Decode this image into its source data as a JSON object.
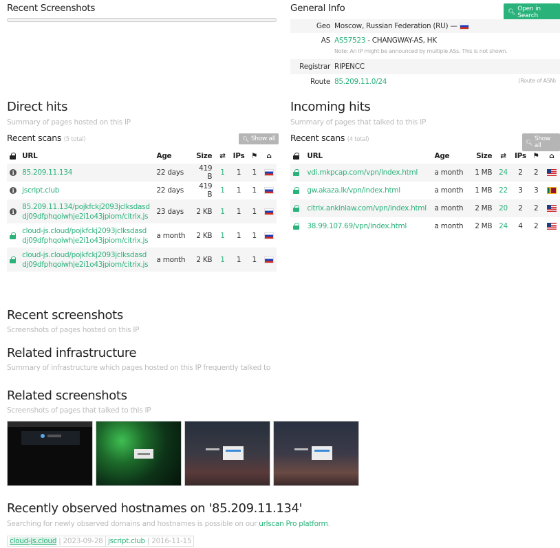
{
  "left_top": {
    "title": "Recent Screenshots"
  },
  "general": {
    "title": "General Info",
    "open_button": "Open in Search",
    "geo_label": "Geo",
    "geo_value": "Moscow, Russian Federation (RU) —",
    "as_label": "AS",
    "as_link": "AS57523",
    "as_rest": "- CHANGWAY-AS, HK",
    "as_note": "Note: An IP might be announced by multiple ASs. This is not shown.",
    "registrar_label": "Registrar",
    "registrar_value": "RIPENCC",
    "route_label": "Route",
    "route_value": "85.209.11.0/24",
    "route_note": "(Route of ASN)"
  },
  "direct": {
    "title": "Direct hits",
    "subtitle": "Summary of pages hosted on this IP",
    "recent_label": "Recent scans",
    "recent_count": "(5 total)",
    "show_all": "Show all",
    "headers": {
      "url": "URL",
      "age": "Age",
      "size": "Size",
      "ips": "IPs"
    },
    "rows": [
      {
        "icon": "info-icon",
        "url1": "85.209.11.134",
        "url2": "",
        "age": "22 days",
        "size": "419 B",
        "req": "1",
        "ips": "1",
        "ctry": "1",
        "flag": "ru"
      },
      {
        "icon": "info-icon",
        "url1": "jscript.club",
        "url2": "",
        "age": "22 days",
        "size": "419 B",
        "req": "1",
        "ips": "1",
        "ctry": "1",
        "flag": "ru"
      },
      {
        "icon": "info-icon",
        "url1": "85.209.11.134/pojkfckj2093jclksdasd",
        "url2": "dj09dfphqoiwhje2i1o43jpiom/citrix.js",
        "age": "23 days",
        "size": "2 KB",
        "req": "1",
        "ips": "1",
        "ctry": "1",
        "flag": "ru"
      },
      {
        "icon": "lock-icon",
        "url1": "cloud-js.cloud/pojkfckj2093jclksdasd",
        "url2": "dj09dfphqoiwhje2i1o43jpiom/citrix.js",
        "age": "a month",
        "size": "2 KB",
        "req": "1",
        "ips": "1",
        "ctry": "1",
        "flag": "ru"
      },
      {
        "icon": "lock-icon",
        "url1": "cloud-js.cloud/pojkfckj2093jclksdasd",
        "url2": "dj09dfphqoiwhje2i1o43jpiom/citrix.js",
        "age": "a month",
        "size": "2 KB",
        "req": "1",
        "ips": "1",
        "ctry": "1",
        "flag": "ru"
      }
    ]
  },
  "incoming": {
    "title": "Incoming hits",
    "subtitle": "Summary of pages that talked to this IP",
    "recent_label": "Recent scans",
    "recent_count": "(4 total)",
    "show_all": "Show all",
    "headers": {
      "url": "URL",
      "age": "Age",
      "size": "Size",
      "ips": "IPs"
    },
    "rows": [
      {
        "url": "vdi.mkpcap.com/vpn/index.html",
        "age": "a month",
        "size": "1 MB",
        "req": "24",
        "ips": "2",
        "ctry": "2",
        "flag": "us"
      },
      {
        "url": "gw.akaza.lk/vpn/index.html",
        "age": "a month",
        "size": "1 MB",
        "req": "22",
        "ips": "3",
        "ctry": "3",
        "flag": "lk"
      },
      {
        "url": "citrix.ankinlaw.com/vpn/index.html",
        "age": "a month",
        "size": "2 MB",
        "req": "20",
        "ips": "2",
        "ctry": "2",
        "flag": "us"
      },
      {
        "url": "38.99.107.69/vpn/index.html",
        "age": "a month",
        "size": "2 MB",
        "req": "24",
        "ips": "4",
        "ctry": "2",
        "flag": "us"
      }
    ]
  },
  "recent_screenshots": {
    "title": "Recent screenshots",
    "subtitle": "Screenshots of pages hosted on this IP"
  },
  "related_infra": {
    "title": "Related infrastructure",
    "subtitle": "Summary of infrastructure which pages hosted on this IP frequently talked to"
  },
  "related_screenshots": {
    "title": "Related screenshots",
    "subtitle": "Screenshots of pages that talked to this IP"
  },
  "hostnames": {
    "title": "Recently observed hostnames on '85.209.11.134'",
    "subtitle_pre": "Searching for newly observed domains and hostnames is possible on our",
    "subtitle_link": "urlscan Pro platform",
    "subtitle_post": ".",
    "tags": [
      {
        "name": "cloud-js.cloud",
        "date": "2023-09-28"
      },
      {
        "name": "jscript.club",
        "date": "2016-11-15"
      }
    ]
  },
  "colors": {
    "accent": "#2ab27b",
    "muted": "#bbbbbb"
  }
}
